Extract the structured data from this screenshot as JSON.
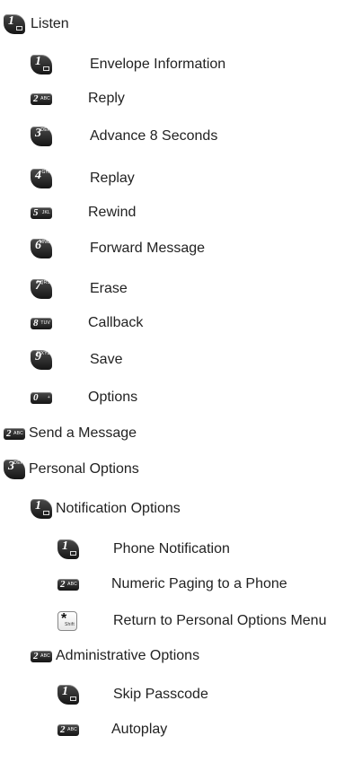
{
  "menu": {
    "listen": "Listen",
    "listen_items": [
      {
        "label": "Envelope Information",
        "num": "1",
        "sub": ""
      },
      {
        "label": "Reply",
        "num": "2",
        "sub": "ABC"
      },
      {
        "label": "Advance 8 Seconds",
        "num": "3",
        "sub": "DEF"
      },
      {
        "label": "Replay",
        "num": "4",
        "sub": "GHI"
      },
      {
        "label": "Rewind",
        "num": "5",
        "sub": "JKL"
      },
      {
        "label": "Forward Message",
        "num": "6",
        "sub": "MNO"
      },
      {
        "label": "Erase",
        "num": "7",
        "sub": "PQRS"
      },
      {
        "label": "Callback",
        "num": "8",
        "sub": "TUV"
      },
      {
        "label": "Save",
        "num": "9",
        "sub": "WXYZ"
      },
      {
        "label": "Options",
        "num": "0",
        "sub": "+"
      }
    ],
    "send": "Send a Message",
    "send_key": {
      "num": "2",
      "sub": "ABC"
    },
    "personal": "Personal Options",
    "personal_key": {
      "num": "3",
      "sub": "DEF"
    },
    "notification": "Notification Options",
    "notification_items": [
      {
        "label": "Phone Notification",
        "num": "1",
        "sub": ""
      },
      {
        "label": "Numeric Paging to a Phone",
        "num": "2",
        "sub": "ABC"
      },
      {
        "label": "Return to Personal Options Menu",
        "num": "*",
        "sub": "Shift"
      }
    ],
    "administrative": "Administrative Options",
    "administrative_key": {
      "num": "2",
      "sub": "ABC"
    },
    "administrative_items": [
      {
        "label": "Skip Passcode",
        "num": "1",
        "sub": ""
      },
      {
        "label": "Autoplay",
        "num": "2",
        "sub": "ABC"
      }
    ]
  }
}
